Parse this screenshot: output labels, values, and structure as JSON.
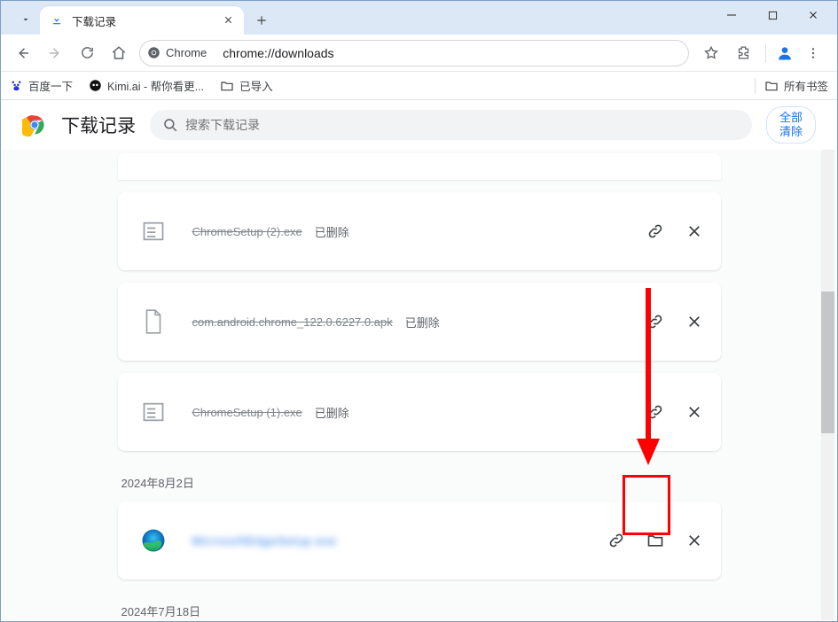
{
  "window": {
    "tab_title": "下载记录",
    "minimize": "—",
    "maximize": "☐",
    "close": "✕"
  },
  "toolbar": {
    "chrome_chip": "Chrome",
    "url": "chrome://downloads"
  },
  "bookmarks": {
    "baidu": "百度一下",
    "kimi": "Kimi.ai - 帮你看更...",
    "imported": "已导入",
    "all": "所有书签"
  },
  "page": {
    "title": "下载记录",
    "search_placeholder": "搜索下载记录",
    "clear_all": "全部\n清除"
  },
  "downloads": {
    "items": [
      {
        "name": "ChromeSetup (2).exe",
        "status": "已删除",
        "deleted": true,
        "icon": "generic"
      },
      {
        "name": "com.android.chrome_122.0.6227.0.apk",
        "status": "已删除",
        "deleted": true,
        "icon": "file"
      },
      {
        "name": "ChromeSetup (1).exe",
        "status": "已删除",
        "deleted": true,
        "icon": "generic"
      }
    ],
    "date2": "2024年8月2日",
    "edge_item": {
      "name_blur": "MicrosoftEdgeSetup.exe",
      "icon": "edge"
    },
    "date3": "2024年7月18日"
  }
}
